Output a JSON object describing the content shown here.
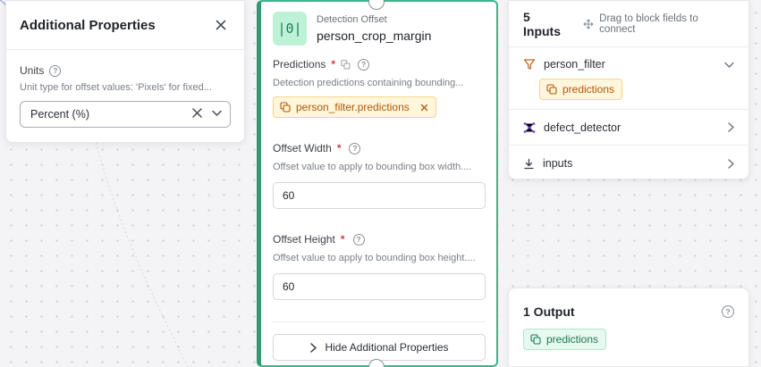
{
  "additional_properties": {
    "title": "Additional Properties",
    "units": {
      "label": "Units",
      "description": "Unit type for offset values: 'Pixels' for fixed...",
      "selected": "Percent (%)"
    }
  },
  "node": {
    "type": "Detection Offset",
    "name": "person_crop_margin",
    "icon_text": "|0|",
    "predictions": {
      "label": "Predictions",
      "required_mark": "*",
      "description": "Detection predictions containing bounding...",
      "chip_label": "person_filter.predictions"
    },
    "offset_width": {
      "label": "Offset Width",
      "required_mark": "*",
      "description": "Offset value to apply to bounding box width....",
      "value": "60"
    },
    "offset_height": {
      "label": "Offset Height",
      "required_mark": "*",
      "description": "Offset value to apply to bounding box height....",
      "value": "60"
    },
    "toggle_label": "Hide Additional Properties"
  },
  "inputs_panel": {
    "count_label": "5 Inputs",
    "hint": "Drag to block fields to connect",
    "items": [
      {
        "label": "person_filter",
        "icon": "filter-icon",
        "expanded": true,
        "chip": "predictions"
      },
      {
        "label": "defect_detector",
        "icon": "model-graph-icon",
        "expanded": false
      },
      {
        "label": "inputs",
        "icon": "download-icon",
        "expanded": false
      }
    ]
  },
  "output_panel": {
    "count_label": "1 Output",
    "chip": "predictions"
  },
  "colors": {
    "node_accent": "#3fb58a",
    "chip_orange": "#b0580a",
    "chip_green": "#1c7a52",
    "required": "#d43b3b"
  }
}
